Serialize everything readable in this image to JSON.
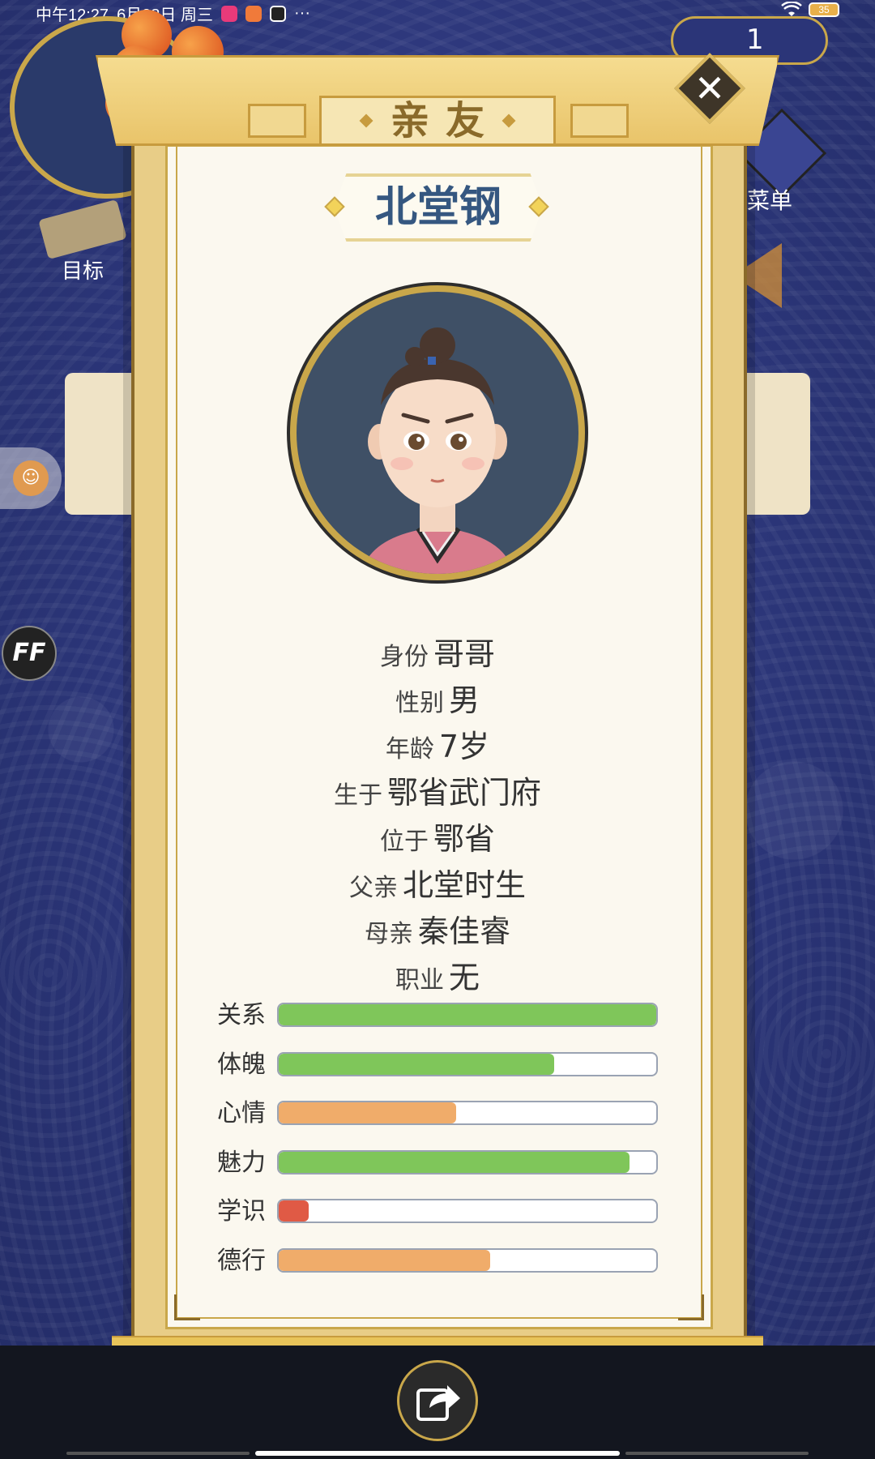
{
  "status_bar": {
    "time": "中午12:27",
    "date": "6月28日 周三",
    "more": "···",
    "battery": "35"
  },
  "background": {
    "goal_label": "目标",
    "menu_label": "菜单",
    "currency_value": "1",
    "ff_label": "FF",
    "assist_icon": "accessibility-icon"
  },
  "dialog": {
    "title": "亲友",
    "close_icon": "close-icon",
    "character_name": "北堂钢",
    "info": [
      {
        "key": "身份",
        "value": "哥哥"
      },
      {
        "key": "性别",
        "value": "男"
      },
      {
        "key": "年龄",
        "value": "7岁"
      },
      {
        "key": "生于",
        "value": "鄂省武门府"
      },
      {
        "key": "位于",
        "value": "鄂省"
      },
      {
        "key": "父亲",
        "value": "北堂时生"
      },
      {
        "key": "母亲",
        "value": "秦佳睿"
      },
      {
        "key": "职业",
        "value": "无"
      }
    ],
    "stats": [
      {
        "label": "关系",
        "value": 1.0,
        "color": "#7fc65a"
      },
      {
        "label": "体魄",
        "value": 0.73,
        "color": "#7fc65a"
      },
      {
        "label": "心情",
        "value": 0.47,
        "color": "#f0ac6a"
      },
      {
        "label": "魅力",
        "value": 0.93,
        "color": "#7fc65a"
      },
      {
        "label": "学识",
        "value": 0.08,
        "color": "#e05a45"
      },
      {
        "label": "德行",
        "value": 0.56,
        "color": "#f0ac6a"
      }
    ]
  },
  "bottom_bar": {
    "share_icon": "share-icon"
  },
  "colors": {
    "background": "#2b3578",
    "panel": "#fbf8ef",
    "gold": "#c9a74a",
    "name_blue": "#355780"
  }
}
